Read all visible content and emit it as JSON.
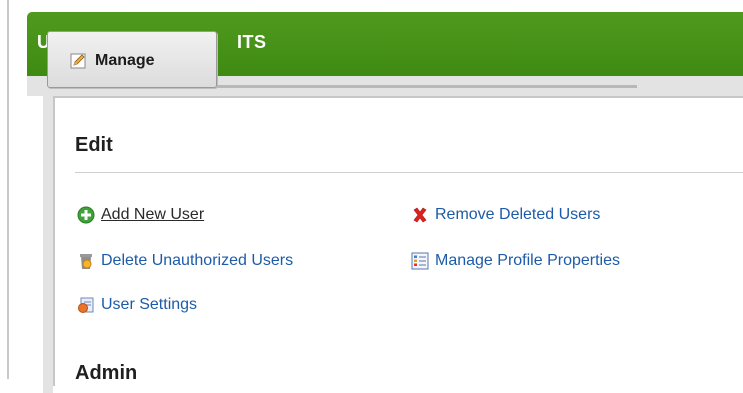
{
  "header": {
    "title_left_fragment": "U",
    "title_right_fragment": "ITS"
  },
  "manage_tab": {
    "label": "Manage",
    "icon": "pencil-icon"
  },
  "sections": {
    "edit": {
      "heading": "Edit",
      "actions": [
        {
          "label": "Add New User",
          "icon": "add-circle-icon"
        },
        {
          "label": "Delete Unauthorized Users",
          "icon": "trash-can-icon"
        },
        {
          "label": "User Settings",
          "icon": "user-settings-icon"
        },
        {
          "label": "Remove Deleted Users",
          "icon": "red-x-icon"
        },
        {
          "label": "Manage Profile Properties",
          "icon": "profile-list-icon"
        }
      ]
    },
    "admin": {
      "heading": "Admin"
    }
  },
  "colors": {
    "header_green": "#4a951b",
    "link_blue": "#1d5ba8",
    "panel_gray": "#e3e3e3"
  }
}
